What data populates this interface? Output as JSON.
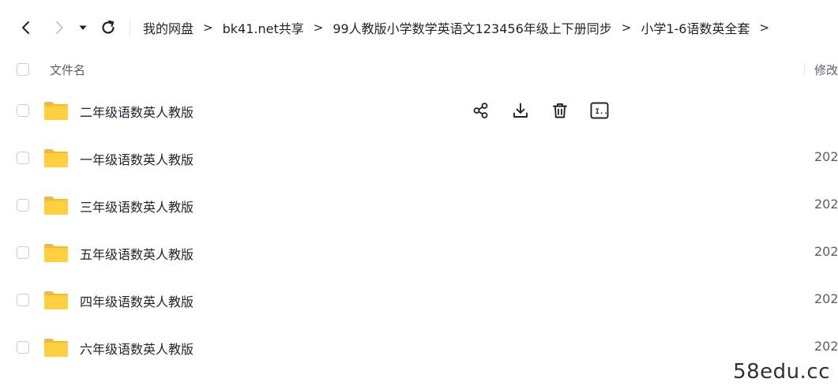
{
  "breadcrumb": [
    "我的网盘",
    "bk41.net共享",
    "99人教版小学数学英语文123456年级上下册同步",
    "小学1-6语数英全套"
  ],
  "breadcrumb_separator": ">",
  "header": {
    "name_label": "文件名",
    "modified_label": "修改"
  },
  "files": [
    {
      "name": "二年级语数英人教版",
      "date": ""
    },
    {
      "name": "一年级语数英人教版",
      "date": "202"
    },
    {
      "name": "三年级语数英人教版",
      "date": "202"
    },
    {
      "name": "五年级语数英人教版",
      "date": "202"
    },
    {
      "name": "四年级语数英人教版",
      "date": "202"
    },
    {
      "name": "六年级语数英人教版",
      "date": "202"
    }
  ],
  "row_action_icons": [
    "share-icon",
    "download-icon",
    "delete-icon",
    "rename-icon"
  ],
  "rename_icon_text": "I..",
  "watermark": "58edu.cc",
  "colors": {
    "folder": "#ffcf3f",
    "folder_tab": "#f7b928",
    "text": "#1f2329",
    "muted": "#5a5f66",
    "border": "#c9cdd4"
  }
}
